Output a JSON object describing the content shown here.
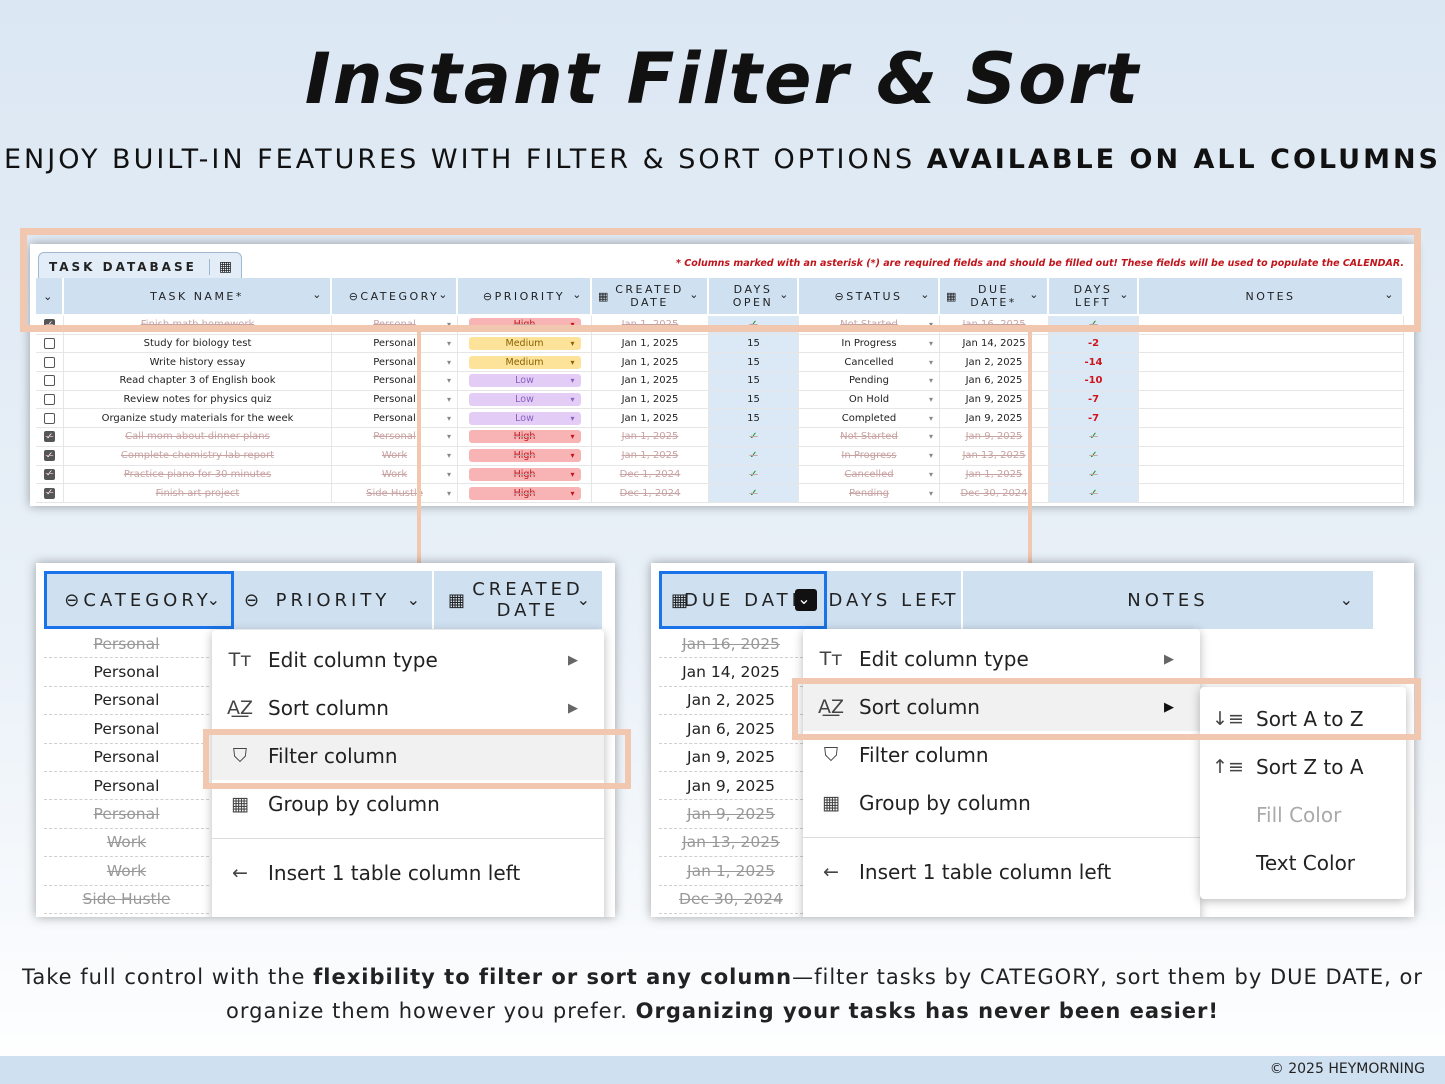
{
  "title": "Instant Filter & Sort",
  "subtitle_plain": "ENJOY BUILT-IN FEATURES WITH FILTER & SORT OPTIONS ",
  "subtitle_bold": "AVAILABLE ON ALL COLUMNS",
  "sheet": {
    "tab_label": "TASK DATABASE",
    "tab_icon": "table-icon",
    "note": "* Columns marked with an asterisk (*) are required fields and should be filled out! These fields will be used to populate the CALENDAR.",
    "headers": {
      "task_name": "TASK NAME*",
      "category": "CATEGORY",
      "priority": "PRIORITY",
      "created_date": "CREATED DATE",
      "days_open": "DAYS OPEN",
      "status": "STATUS",
      "due_date": "DUE DATE*",
      "days_left": "DAYS LEFT",
      "notes": "NOTES"
    },
    "rows": [
      {
        "done": true,
        "task": "Finish math homework",
        "category": "Personal",
        "priority": "High",
        "created": "Jan 1, 2025",
        "days_open": "✓",
        "status": "Not Started",
        "due": "Jan 16, 2025",
        "days_left": "✓"
      },
      {
        "done": false,
        "task": "Study for biology test",
        "category": "Personal",
        "priority": "Medium",
        "created": "Jan 1, 2025",
        "days_open": "15",
        "status": "In Progress",
        "due": "Jan 14, 2025",
        "days_left": "-2"
      },
      {
        "done": false,
        "task": "Write history essay",
        "category": "Personal",
        "priority": "Medium",
        "created": "Jan 1, 2025",
        "days_open": "15",
        "status": "Cancelled",
        "due": "Jan 2, 2025",
        "days_left": "-14"
      },
      {
        "done": false,
        "task": "Read chapter 3 of English book",
        "category": "Personal",
        "priority": "Low",
        "created": "Jan 1, 2025",
        "days_open": "15",
        "status": "Pending",
        "due": "Jan 6, 2025",
        "days_left": "-10"
      },
      {
        "done": false,
        "task": "Review notes for physics quiz",
        "category": "Personal",
        "priority": "Low",
        "created": "Jan 1, 2025",
        "days_open": "15",
        "status": "On Hold",
        "due": "Jan 9, 2025",
        "days_left": "-7"
      },
      {
        "done": false,
        "task": "Organize study materials for the week",
        "category": "Personal",
        "priority": "Low",
        "created": "Jan 1, 2025",
        "days_open": "15",
        "status": "Completed",
        "due": "Jan 9, 2025",
        "days_left": "-7"
      },
      {
        "done": true,
        "task": "Call mom about dinner plans",
        "category": "Personal",
        "priority": "High",
        "created": "Jan 1, 2025",
        "days_open": "✓",
        "status": "Not Started",
        "due": "Jan 9, 2025",
        "days_left": "✓"
      },
      {
        "done": true,
        "task": "Complete chemistry lab report",
        "category": "Work",
        "priority": "High",
        "created": "Jan 1, 2025",
        "days_open": "✓",
        "status": "In Progress",
        "due": "Jan 13, 2025",
        "days_left": "✓"
      },
      {
        "done": true,
        "task": "Practice piano for 30 minutes",
        "category": "Work",
        "priority": "High",
        "created": "Dec 1, 2024",
        "days_open": "✓",
        "status": "Cancelled",
        "due": "Jan 1, 2025",
        "days_left": "✓"
      },
      {
        "done": true,
        "task": "Finish art project",
        "category": "Side Hustle",
        "priority": "High",
        "created": "Dec 1, 2024",
        "days_open": "✓",
        "status": "Pending",
        "due": "Dec 30, 2024",
        "days_left": "✓"
      }
    ]
  },
  "zoom_left": {
    "headers": {
      "category": "CATEGORY",
      "priority": "PRIORITY",
      "created_date": "CREATED DATE"
    },
    "cells": [
      {
        "text": "Personal",
        "struck": true
      },
      {
        "text": "Personal",
        "struck": false
      },
      {
        "text": "Personal",
        "struck": false
      },
      {
        "text": "Personal",
        "struck": false
      },
      {
        "text": "Personal",
        "struck": false
      },
      {
        "text": "Personal",
        "struck": false
      },
      {
        "text": "Personal",
        "struck": true
      },
      {
        "text": "Work",
        "struck": true
      },
      {
        "text": "Work",
        "struck": true
      },
      {
        "text": "Side Hustle",
        "struck": true
      }
    ],
    "menu": {
      "edit": "Edit column type",
      "sort": "Sort column",
      "filter": "Filter column",
      "group": "Group by column",
      "insert": "Insert 1 table column left"
    }
  },
  "zoom_right": {
    "headers": {
      "due_date": "DUE DATE*",
      "days_left": "DAYS LEFT",
      "notes": "NOTES"
    },
    "cells": [
      {
        "text": "Jan 16, 2025",
        "struck": true
      },
      {
        "text": "Jan 14, 2025",
        "struck": false
      },
      {
        "text": "Jan 2, 2025",
        "struck": false
      },
      {
        "text": "Jan 6, 2025",
        "struck": false
      },
      {
        "text": "Jan 9, 2025",
        "struck": false
      },
      {
        "text": "Jan 9, 2025",
        "struck": false
      },
      {
        "text": "Jan 9, 2025",
        "struck": true
      },
      {
        "text": "Jan 13, 2025",
        "struck": true
      },
      {
        "text": "Jan 1, 2025",
        "struck": true
      },
      {
        "text": "Dec 30, 2024",
        "struck": true
      }
    ],
    "menu": {
      "edit": "Edit column type",
      "sort": "Sort column",
      "filter": "Filter column",
      "group": "Group by column",
      "insert": "Insert 1 table column left"
    },
    "submenu": {
      "a_to_z": "Sort A to Z",
      "z_to_a": "Sort Z to A",
      "fill": "Fill Color",
      "text": "Text Color"
    }
  },
  "footer": {
    "p1": "Take full control with the ",
    "b1": "flexibility to filter or sort any column",
    "p2": "—filter tasks by CATEGORY, sort them by DUE DATE, or organize them however you prefer. ",
    "b2": "Organizing your tasks has never been easier!",
    "copyright": "© 2025 HEYMORNING"
  },
  "colors": {
    "high": "#f8b4b4",
    "medium": "#fde29a",
    "low": "#e3cdf6",
    "header": "#cfe0f1",
    "highlight": "#f1c7b0",
    "selection": "#1a73e8"
  }
}
